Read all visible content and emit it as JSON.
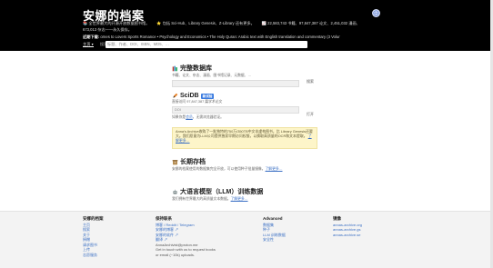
{
  "header": {
    "title": "安娜的档案",
    "line1_a": "📚 全世界最大的开源开放数据图书馆。",
    "line1_b": "⭐️ 包括 Sci-Hub、Library Genesis、Z-Library 还有更多。",
    "line1_c": "📈 22,583,743 书籍、97,847,387 论文、2,451,032 漫画、",
    "line2": "673,013 杂志——永久保存。",
    "line3_label": "近期下载:",
    "line3_text": "ornes to Lovers Sports Romance • Psychology and Economics • The Holy Quran: Arabic text with English translation and commentary (3 Volur",
    "search_placeholder": "标题、作者、DOI、ISBN、MD5、…",
    "right_text": "搜索 | 捐赠 ▾"
  },
  "nav": {
    "home": "主页",
    "home_caret": "▾",
    "search": "搜索"
  },
  "sections": {
    "full_db": {
      "title": "完整数据库",
      "sub": "书籍、论文、杂志、漫画、图书馆记录、元数据、…",
      "button": "搜索"
    },
    "scidb": {
      "title": "SciDB",
      "badge": "新试验",
      "sub": "直接访问 97,847,387 篇学术论文",
      "input_placeholder": "DOI",
      "button": "打开",
      "note_prefix": "如果你是",
      "note_link": "会员",
      "note_suffix": "，无需浏览器验证。"
    },
    "notice": {
      "text": "Anna's Archive收购了一批独特的750万/350TB中文非虚构图书，比 Library Genesis还要大。我们愿意为LLM公司提供独家早期访问权限，以换取高质量的OCR和文本提取。",
      "link": "了解更多…"
    },
    "long_term": {
      "title": "长期存档",
      "sub_text": "安娜的档案使用的数据集完全开放，可以使用种子批量镜像。",
      "sub_link": "了解更多…"
    },
    "llm": {
      "title": "大语言模型（LLM）训练数据",
      "sub_text": "我们拥有世界最大的高质量文本数据。",
      "sub_link": "了解更多…"
    }
  },
  "footer": {
    "col1": {
      "heading": "安娜的档案",
      "items": [
        "主页",
        "搜索",
        "关于",
        "捐赠",
        "请求图书",
        "上传",
        "志愿服务"
      ]
    },
    "col2": {
      "heading": "保持联系",
      "items": [
        "博客 / Reddit / Telegram",
        "安娜的博客 ↗",
        "安娜的软件 ↗",
        "翻译 ↗",
        "AnnaArchivist@proton.me",
        "Get in touch with us to request books",
        "or email (~10k) uploads."
      ]
    },
    "col3": {
      "heading": "Advanced",
      "items": [
        "数据集",
        "种子",
        "LLM 训练数据",
        "安全性"
      ]
    },
    "col4": {
      "heading": "镜像",
      "items": [
        "annas-archive.org",
        "annas-archive.gs",
        "annas-archive.se"
      ]
    }
  },
  "colors": {
    "header_bg": "#000000",
    "link": "#3a6fc4",
    "notice_bg": "#fdf5c9",
    "badge": "#3a7be0"
  },
  "icons": {
    "full_db": "books-icon",
    "scidb": "pen-icon",
    "long_term": "archive-box-icon",
    "llm": "robot-icon",
    "language": "globe-icon"
  }
}
